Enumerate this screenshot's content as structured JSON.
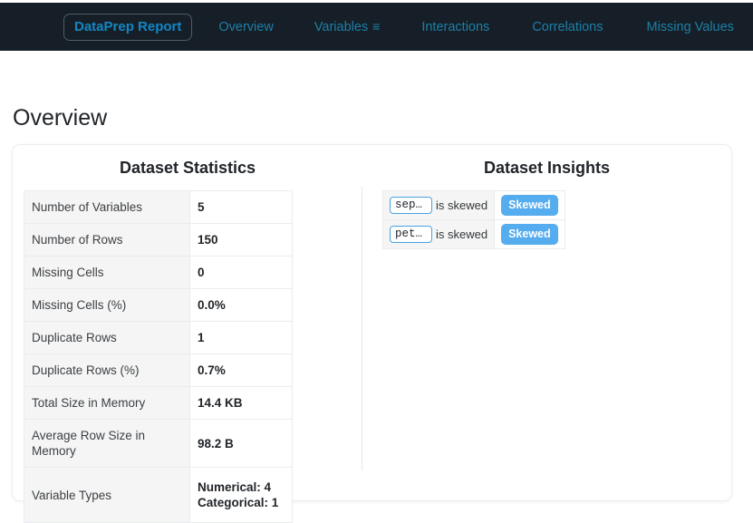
{
  "navbar": {
    "brand": "DataPrep Report",
    "menu_icon": "hamburger-icon",
    "links": [
      {
        "label": "Overview",
        "name": "nav-link-overview"
      },
      {
        "label": "Variables",
        "name": "nav-link-variables",
        "caret": "≡"
      },
      {
        "label": "Interactions",
        "name": "nav-link-interactions"
      },
      {
        "label": "Correlations",
        "name": "nav-link-correlations"
      },
      {
        "label": "Missing Values",
        "name": "nav-link-missing-values"
      }
    ],
    "background_color": "#161f27",
    "link_color": "#1d7fa7",
    "brand_color": "#1287c4"
  },
  "page": {
    "title": "Overview"
  },
  "stats_panel": {
    "title": "Dataset Statistics",
    "rows": [
      {
        "key": "Number of Variables",
        "value": "5"
      },
      {
        "key": "Number of Rows",
        "value": "150"
      },
      {
        "key": "Missing Cells",
        "value": "0"
      },
      {
        "key": "Missing Cells (%)",
        "value": "0.0%"
      },
      {
        "key": "Duplicate Rows",
        "value": "1"
      },
      {
        "key": "Duplicate Rows (%)",
        "value": "0.7%"
      },
      {
        "key": "Total Size in Memory",
        "value": "14.4 KB"
      },
      {
        "key": "Average Row Size in Memory",
        "value": "98.2 B"
      }
    ],
    "variable_types": {
      "key": "Variable Types",
      "line1": "Numerical: 4",
      "line2": "Categorical: 1"
    }
  },
  "insights_panel": {
    "title": "Dataset Insights",
    "badge_color": "#55acee",
    "rows": [
      {
        "column": "sepa…",
        "message": "is skewed",
        "badge": "Skewed"
      },
      {
        "column": "peta…",
        "message": "is skewed",
        "badge": "Skewed"
      }
    ]
  }
}
